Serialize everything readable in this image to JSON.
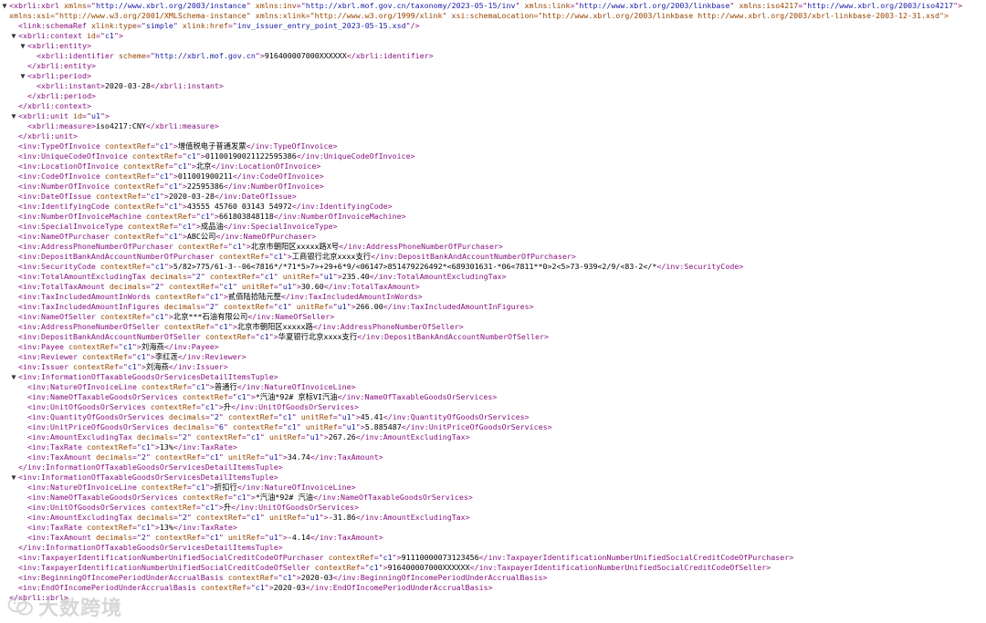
{
  "watermark": {
    "text": "大数跨境",
    "icon": "wechat-logo-icon"
  },
  "colors": {
    "tag": "#881280",
    "attr_name": "#994500",
    "attr_value": "#1a1aa6",
    "text": "#000000",
    "background": "#ffffff"
  },
  "lines": [
    {
      "ind": 0,
      "tg": "▼",
      "k": "o",
      "n": "xbrli:xbrl",
      "a": [
        [
          "xmlns",
          "http://www.xbrl.org/2003/instance"
        ],
        [
          "xmlns:inv",
          "http://xbrl.mof.gov.cn/taxonomy/2023-05-15/inv"
        ],
        [
          "xmlns:link",
          "http://www.xbrl.org/2003/linkbase"
        ],
        [
          "xmlns:iso4217",
          "http://www.xbrl.org/2003/iso4217"
        ]
      ]
    },
    {
      "ind": 0,
      "k": "c",
      "x": "xmlns:xsi=\"http://www.w3.org/2001/XMLSchema-instance\" xmlns:xlink=\"http://www.w3.org/1999/xlink\" xsi:schemaLocation=\"http://www.xbrl.org/2003/linkbase http://www.xbrl.org/2003/xbrl-linkbase-2003-12-31.xsd\">"
    },
    {
      "ind": 1,
      "k": "s",
      "n": "link:schemaRef",
      "a": [
        [
          "xlink:type",
          "simple"
        ],
        [
          "xlink:href",
          "inv_issuer_entry_point_2023-05-15.xsd"
        ]
      ]
    },
    {
      "ind": 1,
      "tg": "▼",
      "k": "o",
      "n": "xbrli:context",
      "a": [
        [
          "id",
          "c1"
        ]
      ]
    },
    {
      "ind": 2,
      "tg": "▼",
      "k": "o",
      "n": "xbrli:entity"
    },
    {
      "ind": 3,
      "k": "e",
      "n": "xbrli:identifier",
      "a": [
        [
          "scheme",
          "http://xbrl.mof.gov.cn"
        ]
      ],
      "v": "916400007000XXXXXX"
    },
    {
      "ind": 2,
      "k": "x",
      "n": "xbrli:entity"
    },
    {
      "ind": 2,
      "tg": "▼",
      "k": "o",
      "n": "xbrli:period"
    },
    {
      "ind": 3,
      "k": "e",
      "n": "xbrli:instant",
      "v": "2020-03-28"
    },
    {
      "ind": 2,
      "k": "x",
      "n": "xbrli:period"
    },
    {
      "ind": 1,
      "k": "x",
      "n": "xbrli:context"
    },
    {
      "ind": 1,
      "tg": "▼",
      "k": "o",
      "n": "xbrli:unit",
      "a": [
        [
          "id",
          "u1"
        ]
      ]
    },
    {
      "ind": 2,
      "k": "e",
      "n": "xbrli:measure",
      "v": "iso4217:CNY"
    },
    {
      "ind": 1,
      "k": "x",
      "n": "xbrli:unit"
    },
    {
      "ind": 1,
      "k": "e",
      "n": "inv:TypeOfInvoice",
      "a": [
        [
          "contextRef",
          "c1"
        ]
      ],
      "v": "增值税电子普通发票"
    },
    {
      "ind": 1,
      "k": "e",
      "n": "inv:UniqueCodeOfInvoice",
      "a": [
        [
          "contextRef",
          "c1"
        ]
      ],
      "v": "01100190021122595386"
    },
    {
      "ind": 1,
      "k": "e",
      "n": "inv:LocationOfInvoice",
      "a": [
        [
          "contextRef",
          "c1"
        ]
      ],
      "v": "北京"
    },
    {
      "ind": 1,
      "k": "e",
      "n": "inv:CodeOfInvoice",
      "a": [
        [
          "contextRef",
          "c1"
        ]
      ],
      "v": "011001900211"
    },
    {
      "ind": 1,
      "k": "e",
      "n": "inv:NumberOfInvoice",
      "a": [
        [
          "contextRef",
          "c1"
        ]
      ],
      "v": "22595386"
    },
    {
      "ind": 1,
      "k": "e",
      "n": "inv:DateOfIssue",
      "a": [
        [
          "contextRef",
          "c1"
        ]
      ],
      "v": "2020-03-28"
    },
    {
      "ind": 1,
      "k": "e",
      "n": "inv:IdentifyingCode",
      "a": [
        [
          "contextRef",
          "c1"
        ]
      ],
      "v": "43555 45760 03143 54972"
    },
    {
      "ind": 1,
      "k": "e",
      "n": "inv:NumberOfInvoiceMachine",
      "a": [
        [
          "contextRef",
          "c1"
        ]
      ],
      "v": "661803848118"
    },
    {
      "ind": 1,
      "k": "e",
      "n": "inv:SpecialInvoiceType",
      "a": [
        [
          "contextRef",
          "c1"
        ]
      ],
      "v": "成品油"
    },
    {
      "ind": 1,
      "k": "e",
      "n": "inv:NameOfPurchaser",
      "a": [
        [
          "contextRef",
          "c1"
        ]
      ],
      "v": "ABC公司"
    },
    {
      "ind": 1,
      "k": "e",
      "n": "inv:AddressPhoneNumberOfPurchaser",
      "a": [
        [
          "contextRef",
          "c1"
        ]
      ],
      "v": "北京市朝阳区xxxxx路X号"
    },
    {
      "ind": 1,
      "k": "e",
      "n": "inv:DepositBankAndAccountNumberOfPurchaser",
      "a": [
        [
          "contextRef",
          "c1"
        ]
      ],
      "v": "工商银行北京xxxx支行"
    },
    {
      "ind": 1,
      "k": "e",
      "n": "inv:SecurityCode",
      "a": [
        [
          "contextRef",
          "c1"
        ]
      ],
      "v": "5/82>775/61-3--06<7816*/*71*5>7>+29+6*9/<06147>851479226492*<689301631-*06<7811**0>2<5>73-939<2/9/<83-2</*"
    },
    {
      "ind": 1,
      "k": "e",
      "n": "inv:TotalAmountExcludingTax",
      "a": [
        [
          "decimals",
          "2"
        ],
        [
          "contextRef",
          "c1"
        ],
        [
          "unitRef",
          "u1"
        ]
      ],
      "v": "235.40"
    },
    {
      "ind": 1,
      "k": "e",
      "n": "inv:TotalTaxAmount",
      "a": [
        [
          "decimals",
          "2"
        ],
        [
          "contextRef",
          "c1"
        ],
        [
          "unitRef",
          "u1"
        ]
      ],
      "v": "30.60"
    },
    {
      "ind": 1,
      "k": "e",
      "n": "inv:TaxIncludedAmountInWords",
      "a": [
        [
          "contextRef",
          "c1"
        ]
      ],
      "v": "贰佰陆拾陆元整"
    },
    {
      "ind": 1,
      "k": "e",
      "n": "inv:TaxIncludedAmountInFigures",
      "a": [
        [
          "decimals",
          "2"
        ],
        [
          "contextRef",
          "c1"
        ],
        [
          "unitRef",
          "u1"
        ]
      ],
      "v": "266.00"
    },
    {
      "ind": 1,
      "k": "e",
      "n": "inv:NameOfSeller",
      "a": [
        [
          "contextRef",
          "c1"
        ]
      ],
      "v": "北京***石油有限公司"
    },
    {
      "ind": 1,
      "k": "e",
      "n": "inv:AddressPhoneNumberOfSeller",
      "a": [
        [
          "contextRef",
          "c1"
        ]
      ],
      "v": "北京市朝阳区xxxxx路"
    },
    {
      "ind": 1,
      "k": "e",
      "n": "inv:DepositBankAndAccountNumberOfSeller",
      "a": [
        [
          "contextRef",
          "c1"
        ]
      ],
      "v": "华夏银行北京xxxx支行"
    },
    {
      "ind": 1,
      "k": "e",
      "n": "inv:Payee",
      "a": [
        [
          "contextRef",
          "c1"
        ]
      ],
      "v": "刘海燕"
    },
    {
      "ind": 1,
      "k": "e",
      "n": "inv:Reviewer",
      "a": [
        [
          "contextRef",
          "c1"
        ]
      ],
      "v": "李红莲"
    },
    {
      "ind": 1,
      "k": "e",
      "n": "inv:Issuer",
      "a": [
        [
          "contextRef",
          "c1"
        ]
      ],
      "v": "刘海燕"
    },
    {
      "ind": 1,
      "tg": "▼",
      "k": "o",
      "n": "inv:InformationOfTaxableGoodsOrServicesDetailItemsTuple"
    },
    {
      "ind": 2,
      "k": "e",
      "n": "inv:NatureOfInvoiceLine",
      "a": [
        [
          "contextRef",
          "c1"
        ]
      ],
      "v": "普通行"
    },
    {
      "ind": 2,
      "k": "e",
      "n": "inv:NameOfTaxableGoodsOrServices",
      "a": [
        [
          "contextRef",
          "c1"
        ]
      ],
      "v": "*汽油*92# 京标VI汽油"
    },
    {
      "ind": 2,
      "k": "e",
      "n": "inv:UnitOfGoodsOrServices",
      "a": [
        [
          "contextRef",
          "c1"
        ]
      ],
      "v": "升"
    },
    {
      "ind": 2,
      "k": "e",
      "n": "inv:QuantityOfGoodsOrServices",
      "a": [
        [
          "decimals",
          "2"
        ],
        [
          "contextRef",
          "c1"
        ],
        [
          "unitRef",
          "u1"
        ]
      ],
      "v": "45.41"
    },
    {
      "ind": 2,
      "k": "e",
      "n": "inv:UnitPriceOfGoodsOrServices",
      "a": [
        [
          "decimals",
          "6"
        ],
        [
          "contextRef",
          "c1"
        ],
        [
          "unitRef",
          "u1"
        ]
      ],
      "v": "5.885487"
    },
    {
      "ind": 2,
      "k": "e",
      "n": "inv:AmountExcludingTax",
      "a": [
        [
          "decimals",
          "2"
        ],
        [
          "contextRef",
          "c1"
        ],
        [
          "unitRef",
          "u1"
        ]
      ],
      "v": "267.26"
    },
    {
      "ind": 2,
      "k": "e",
      "n": "inv:TaxRate",
      "a": [
        [
          "contextRef",
          "c1"
        ]
      ],
      "v": "13%"
    },
    {
      "ind": 2,
      "k": "e",
      "n": "inv:TaxAmount",
      "a": [
        [
          "decimals",
          "2"
        ],
        [
          "contextRef",
          "c1"
        ],
        [
          "unitRef",
          "u1"
        ]
      ],
      "v": "34.74"
    },
    {
      "ind": 1,
      "k": "x",
      "n": "inv:InformationOfTaxableGoodsOrServicesDetailItemsTuple"
    },
    {
      "ind": 1,
      "tg": "▼",
      "k": "o",
      "n": "inv:InformationOfTaxableGoodsOrServicesDetailItemsTuple"
    },
    {
      "ind": 2,
      "k": "e",
      "n": "inv:NatureOfInvoiceLine",
      "a": [
        [
          "contextRef",
          "c1"
        ]
      ],
      "v": "折扣行"
    },
    {
      "ind": 2,
      "k": "e",
      "n": "inv:NameOfTaxableGoodsOrServices",
      "a": [
        [
          "contextRef",
          "c1"
        ]
      ],
      "v": "*汽油*92# 汽油"
    },
    {
      "ind": 2,
      "k": "e",
      "n": "inv:UnitOfGoodsOrServices",
      "a": [
        [
          "contextRef",
          "c1"
        ]
      ],
      "v": "升"
    },
    {
      "ind": 2,
      "k": "e",
      "n": "inv:AmountExcludingTax",
      "a": [
        [
          "decimals",
          "2"
        ],
        [
          "contextRef",
          "c1"
        ],
        [
          "unitRef",
          "u1"
        ]
      ],
      "v": "-31.86"
    },
    {
      "ind": 2,
      "k": "e",
      "n": "inv:TaxRate",
      "a": [
        [
          "contextRef",
          "c1"
        ]
      ],
      "v": "13%"
    },
    {
      "ind": 2,
      "k": "e",
      "n": "inv:TaxAmount",
      "a": [
        [
          "decimals",
          "2"
        ],
        [
          "contextRef",
          "c1"
        ],
        [
          "unitRef",
          "u1"
        ]
      ],
      "v": "-4.14"
    },
    {
      "ind": 1,
      "k": "x",
      "n": "inv:InformationOfTaxableGoodsOrServicesDetailItemsTuple"
    },
    {
      "ind": 1,
      "k": "e",
      "n": "inv:TaxpayerIdentificationNumberUnifiedSocialCreditCodeOfPurchaser",
      "a": [
        [
          "contextRef",
          "c1"
        ]
      ],
      "v": "91110000073123456"
    },
    {
      "ind": 1,
      "k": "e",
      "n": "inv:TaxpayerIdentificationNumberUnifiedSocialCreditCodeOfSeller",
      "a": [
        [
          "contextRef",
          "c1"
        ]
      ],
      "v": "916400007000XXXXXX"
    },
    {
      "ind": 1,
      "k": "e",
      "n": "inv:BeginningOfIncomePeriodUnderAccrualBasis",
      "a": [
        [
          "contextRef",
          "c1"
        ]
      ],
      "v": "2020-03"
    },
    {
      "ind": 1,
      "k": "e",
      "n": "inv:EndOfIncomePeriodUnderAccrualBasis",
      "a": [
        [
          "contextRef",
          "c1"
        ]
      ],
      "v": "2020-03"
    },
    {
      "ind": 0,
      "k": "x",
      "n": "xbrli:xbrl"
    }
  ]
}
